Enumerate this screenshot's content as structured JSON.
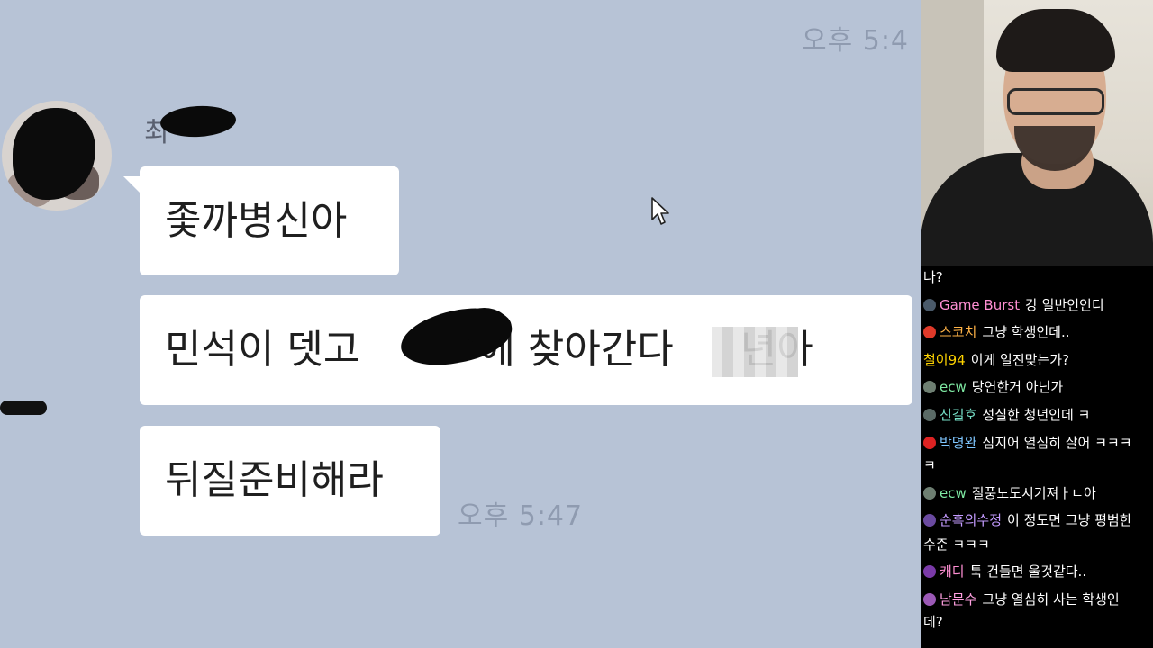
{
  "chat_screenshot": {
    "timestamp_top": "오후 5:4",
    "sender_name": "최",
    "messages": [
      {
        "text": "좇까병신아"
      },
      {
        "text": "민석이 뎃고 ",
        "text_after": "에 찾아간다 ",
        "text_end": "년아"
      },
      {
        "text": "뒤질준비해라"
      }
    ],
    "timestamp_bottom": "오후 5:47"
  },
  "live_chat": [
    {
      "name": "",
      "message": "나?",
      "icon": "none",
      "name_color": "#ffffff",
      "icon_color": "#000000"
    },
    {
      "name": "Game Burst",
      "message": "강 일반인인디",
      "icon": "user-icon",
      "name_color": "#ff8fd3",
      "icon_color": "#4a5a6a"
    },
    {
      "name": "스코치",
      "message": "그냥 학생인데..",
      "icon": "badge-icon",
      "name_color": "#ffb347",
      "icon_color": "#e03a2a"
    },
    {
      "name": "철이94",
      "message": "이게 일진맞는가?",
      "icon": "none",
      "name_color": "#ffd400",
      "icon_color": "#000000"
    },
    {
      "name": "ecw",
      "message": "당연한거 아닌가",
      "icon": "user-icon",
      "name_color": "#7ee8a2",
      "icon_color": "#6e7f72"
    },
    {
      "name": "신길호",
      "message": "성실한 청년인데 ㅋ",
      "icon": "user-icon",
      "name_color": "#77e0c8",
      "icon_color": "#5a6a66"
    },
    {
      "name": "박명완",
      "message": "심지어 열심히 살어 ㅋㅋㅋ",
      "message_wrap": "ㅋ",
      "icon": "badge-icon",
      "name_color": "#7fc6ff",
      "icon_color": "#d22"
    },
    {
      "name": "ecw",
      "message": "질풍노도시기져ㅏㄴ아",
      "icon": "user-icon",
      "name_color": "#7ee8a2",
      "icon_color": "#6e7f72"
    },
    {
      "name": "순흑의수정",
      "message": "이 정도면 그냥 평범한",
      "message_wrap": "수준 ㅋㅋㅋ",
      "icon": "user-icon",
      "name_color": "#c49bff",
      "icon_color": "#6a4aa0"
    },
    {
      "name": "캐디",
      "message": "툭 건들면 울것같다..",
      "icon": "user-icon",
      "name_color": "#ff8fd3",
      "icon_color": "#7a3aa8"
    },
    {
      "name": "남문수",
      "message": "그냥 열심히 사는 학생인",
      "message_wrap": "데?",
      "icon": "user-icon",
      "name_color": "#ff9fe0",
      "icon_color": "#9b59b6"
    }
  ]
}
